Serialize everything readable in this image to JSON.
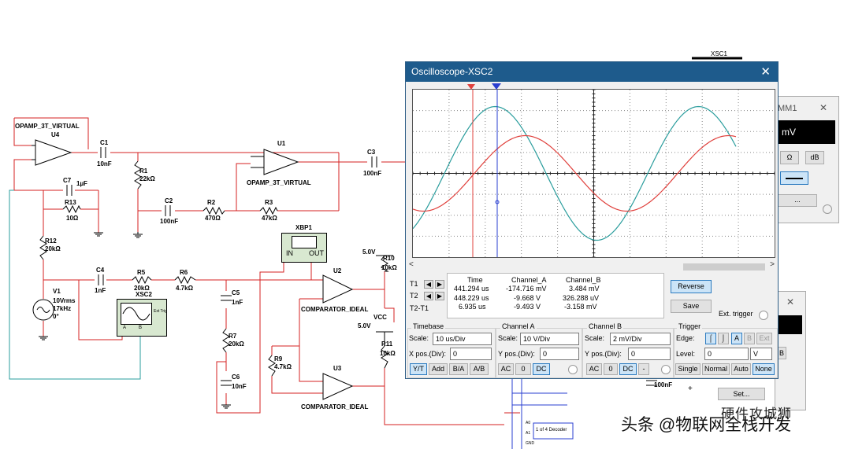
{
  "schematic": {
    "opamp_u4_name": "OPAMP_3T_VIRTUAL",
    "opamp_u4_ref": "U4",
    "opamp_u1_ref": "U1",
    "opamp_u1_name": "OPAMP_3T_VIRTUAL",
    "c1_ref": "C1",
    "c1_val": "10nF",
    "r1_ref": "R1",
    "r1_val": "22kΩ",
    "c7_ref": "C7",
    "c7_val": "1µF",
    "r13_ref": "R13",
    "r13_val": "10Ω",
    "c2_ref": "C2",
    "c2_val": "100nF",
    "r2_ref": "R2",
    "r2_val": "470Ω",
    "r3_ref": "R3",
    "r3_val": "47kΩ",
    "c3_ref": "C3",
    "c3_val": "100nF",
    "r12_ref": "R12",
    "r12_val": "20kΩ",
    "v1_ref": "V1",
    "v1_l1": "10Vrms",
    "v1_l2": "17kHz",
    "v1_l3": "0°",
    "c4_ref": "C4",
    "c4_val": "1nF",
    "r5_ref": "R5",
    "r5_val": "20kΩ",
    "r6_ref": "R6",
    "r6_val": "4.7kΩ",
    "xsc2_ref": "XSC2",
    "xsc2_trig": "Ext Trig",
    "xsc2_a": "A",
    "xsc2_b": "B",
    "xbp1_ref": "XBP1",
    "xbp1_in": "IN",
    "xbp1_out": "OUT",
    "c5_ref": "C5",
    "c5_val": "1nF",
    "r7_ref": "R7",
    "r7_val": "20kΩ",
    "c6_ref": "C6",
    "c6_val": "10nF",
    "r9_ref": "R9",
    "r9_val": "4.7kΩ",
    "u2_ref": "U2",
    "u2_name": "COMPARATOR_IDEAL",
    "u3_ref": "U3",
    "u3_name": "COMPARATOR_IDEAL",
    "v5a": "5.0V",
    "r10_ref": "R10",
    "r10_val": "10kΩ",
    "v5b": "5.0V",
    "vcc": "VCC",
    "r11_ref": "R11",
    "r11_val": "10kΩ",
    "xsc1_ref": "XSC1",
    "c_bottom_val": "100nF",
    "decoder": "1 of 4 Decoder",
    "decoder_pins": [
      "A0",
      "A1",
      "GND"
    ]
  },
  "oscilloscope": {
    "title": "Oscilloscope-XSC2",
    "close": "✕",
    "cursors": {
      "headers": [
        "Time",
        "Channel_A",
        "Channel_B"
      ],
      "rows": [
        {
          "label": "T1",
          "time": "441.294 us",
          "a": "-174.716 mV",
          "b": "3.484 mV"
        },
        {
          "label": "T2",
          "time": "448.229 us",
          "a": "-9.668 V",
          "b": "326.288 uV"
        },
        {
          "label": "T2-T1",
          "time": "6.935 us",
          "a": "-9.493 V",
          "b": "-3.158 mV"
        }
      ]
    },
    "reverse": "Reverse",
    "save": "Save",
    "ext_trigger": "Ext. trigger",
    "timebase": {
      "title": "Timebase",
      "scale_label": "Scale:",
      "scale": "10 us/Div",
      "xpos_label": "X pos.(Div):",
      "xpos": "0",
      "modes": [
        "Y/T",
        "Add",
        "B/A",
        "A/B"
      ]
    },
    "channel_a": {
      "title": "Channel A",
      "scale_label": "Scale:",
      "scale": "10  V/Div",
      "ypos_label": "Y pos.(Div):",
      "ypos": "0",
      "coupling": [
        "AC",
        "0",
        "DC"
      ]
    },
    "channel_b": {
      "title": "Channel B",
      "scale_label": "Scale:",
      "scale": "2 mV/Div",
      "ypos_label": "Y pos.(Div):",
      "ypos": "0",
      "coupling": [
        "AC",
        "0",
        "DC",
        "-"
      ]
    },
    "trigger": {
      "title": "Trigger",
      "edge_label": "Edge:",
      "edge_buttons": [
        "A",
        "B",
        "Ext"
      ],
      "level_label": "Level:",
      "level": "0",
      "level_unit": "V",
      "modes": [
        "Single",
        "Normal",
        "Auto",
        "None"
      ]
    },
    "colors": {
      "channel_a": "#2a9d9d",
      "channel_b": "#e0403c",
      "cursor_t1": "#e0403c",
      "cursor_t2": "#2a3fd0",
      "titlebar": "#1e5b8c"
    }
  },
  "multimeter_partial": {
    "title": "MM1",
    "display": "mV",
    "buttons": [
      "Ω",
      "dB"
    ],
    "settings_dots": "..."
  },
  "function_gen_partial": {
    "plus": "+",
    "set_button": "Set...",
    "btn_b": "B"
  },
  "watermark": {
    "line1": "头条 @物联网全栈开发",
    "line2": "硬件攻城狮"
  }
}
